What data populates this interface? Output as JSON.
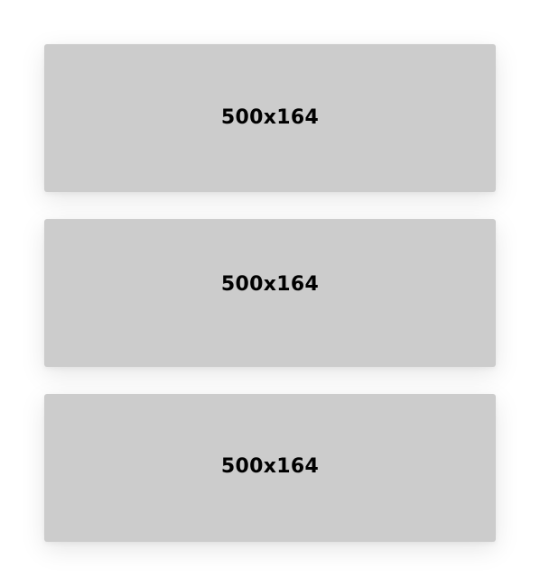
{
  "cards": [
    {
      "label": "500x164"
    },
    {
      "label": "500x164"
    },
    {
      "label": "500x164"
    }
  ],
  "colors": {
    "background": "#ffffff",
    "placeholder": "#cccccc",
    "text": "#000000"
  }
}
